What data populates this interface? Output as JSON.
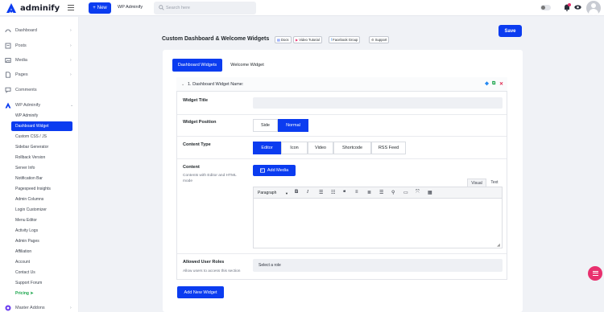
{
  "brand": {
    "name": "adminify",
    "accent": "#0b3cf0",
    "pink": "#e8306e",
    "green": "#1aa54b"
  },
  "topbar": {
    "new_label": "New",
    "site_name": "WP Adminify",
    "search_placeholder": "Search here"
  },
  "sidebar": {
    "items": [
      {
        "label": "Dashboard",
        "icon": "dashboard-icon"
      },
      {
        "label": "Posts",
        "icon": "posts-icon"
      },
      {
        "label": "Media",
        "icon": "media-icon"
      },
      {
        "label": "Pages",
        "icon": "pages-icon"
      },
      {
        "label": "Comments",
        "icon": "comments-icon"
      },
      {
        "label": "WP Adminify",
        "icon": "adminify-icon"
      }
    ],
    "submenu": [
      "WP Adminify",
      "Dashboard Widget",
      "Custom CSS / JS",
      "Sidebar Generator",
      "Rollback Version",
      "Server Info",
      "Notification Bar",
      "Pagespeed Insights",
      "Admin Columns",
      "Login Customizer",
      "Menu Editor",
      "Activity Logs",
      "Admin Pages",
      "Affiliation",
      "Account",
      "Contact Us",
      "Support Forum",
      "Pricing ➤"
    ],
    "active_sub": "Dashboard Widget",
    "bottom_item": "Master Addons"
  },
  "page": {
    "title": "Custom Dashboard & Welcome Widgets",
    "tags": [
      "Docs",
      "Video Tutorial",
      "Facebook Group",
      "Support"
    ],
    "save_label": "Save",
    "tabs": [
      "Dashboard Widgets",
      "Welcome Widget"
    ]
  },
  "widget": {
    "header_title": "1. Dashboard Widget Name:",
    "title_label": "Widget Title",
    "position_label": "Widget Position",
    "position_options": [
      "Side",
      "Normal"
    ],
    "position_selected": "Normal",
    "content_type_label": "Content Type",
    "content_types": [
      "Editor",
      "Icon",
      "Video",
      "Shortcode",
      "RSS Feed"
    ],
    "content_type_selected": "Editor",
    "content_label": "Content",
    "content_desc": "Contents with Editor and HTML mode",
    "add_media_label": "Add Media",
    "editor_tabs": [
      "Visual",
      "Text"
    ],
    "format_select": "Paragraph",
    "roles_label": "Allowed User Roles",
    "roles_desc": "Allow users to access this section",
    "roles_placeholder": "Select a role"
  },
  "add_widget_label": "Add New Widget"
}
